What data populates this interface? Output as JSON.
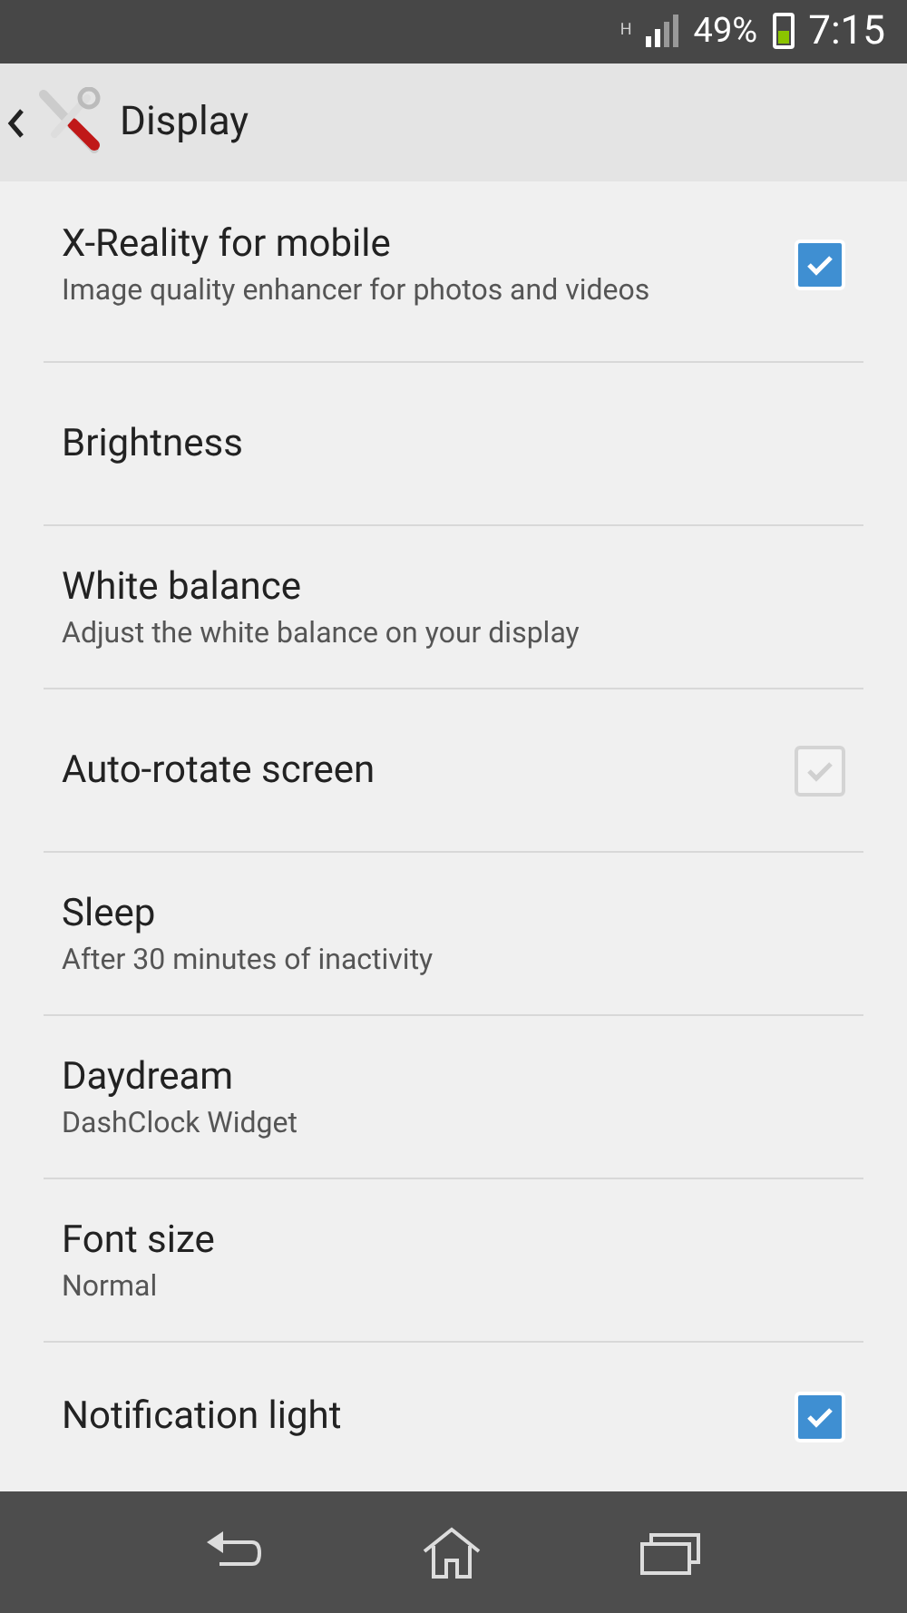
{
  "status_bar": {
    "network": "H",
    "battery": "49%",
    "time": "7:15"
  },
  "action_bar": {
    "title": "Display"
  },
  "settings": [
    {
      "kind": "checkbox",
      "title": "X-Reality for mobile",
      "summary": "Image quality enhancer for photos and videos",
      "checked": true
    },
    {
      "kind": "plain",
      "title": "Brightness"
    },
    {
      "kind": "plain",
      "title": "White balance",
      "summary": "Adjust the white balance on your display"
    },
    {
      "kind": "checkbox",
      "title": "Auto-rotate screen",
      "checked": false
    },
    {
      "kind": "plain",
      "title": "Sleep",
      "summary": "After 30 minutes of inactivity"
    },
    {
      "kind": "plain",
      "title": "Daydream",
      "summary": "DashClock Widget"
    },
    {
      "kind": "plain",
      "title": "Font size",
      "summary": "Normal"
    },
    {
      "kind": "checkbox",
      "title": "Notification light",
      "checked": true
    }
  ]
}
